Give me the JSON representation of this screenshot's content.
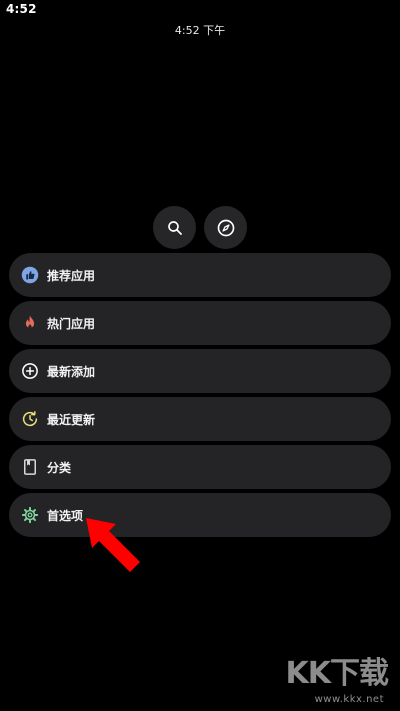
{
  "status_bar": {
    "time": "4:52"
  },
  "clock": {
    "text": "4:52 下午"
  },
  "top_actions": [
    {
      "icon": "search-icon"
    },
    {
      "icon": "compass-icon"
    }
  ],
  "menu": {
    "items": [
      {
        "label": "推荐应用",
        "icon": "thumbs-up-icon",
        "color": "#7ea6e6"
      },
      {
        "label": "热门应用",
        "icon": "flame-icon",
        "color": "#e36b5a"
      },
      {
        "label": "最新添加",
        "icon": "plus-circle-icon",
        "color": "#ffffff"
      },
      {
        "label": "最近更新",
        "icon": "update-clock-icon",
        "color": "#e8e07a"
      },
      {
        "label": "分类",
        "icon": "bookmark-book-icon",
        "color": "#d8d8d8"
      },
      {
        "label": "首选项",
        "icon": "gear-icon",
        "color": "#7ed49a"
      }
    ]
  },
  "annotation": {
    "arrow_color": "#ff0000"
  },
  "watermark": {
    "brand": "KK下载",
    "url": "www.kkx.net"
  }
}
